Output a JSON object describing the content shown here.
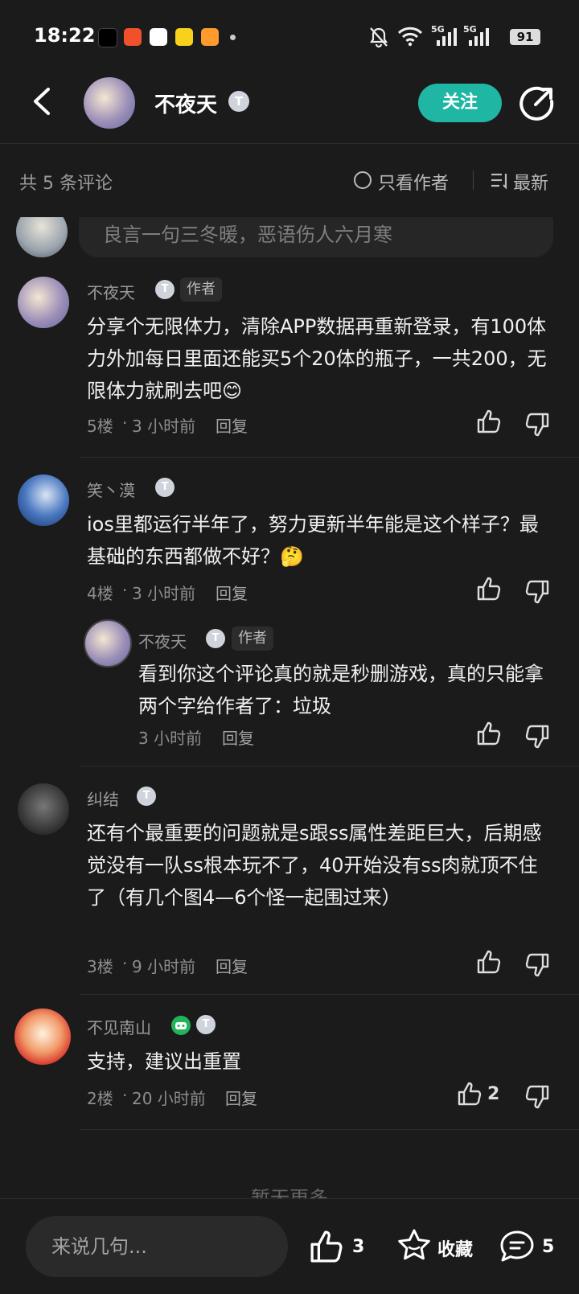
{
  "status_bar": {
    "time": "18:22",
    "network1": "5G",
    "network2": "5G",
    "battery": "91"
  },
  "header": {
    "user_name": "不夜天",
    "badge": "T",
    "follow_label": "关注"
  },
  "toolbar": {
    "comment_count": "共 5 条评论",
    "only_author": "只看作者",
    "sort_label": "最新"
  },
  "prev_comment": {
    "text": "良言一句三冬暖，恶语伤人六月寒"
  },
  "comments": [
    {
      "name": "不夜天",
      "badge": "T",
      "tag": "作者",
      "text": "分享个无限体力，清除APP数据再重新登录，有100体力外加每日里面还能买5个20体的瓶子，一共200，无限体力就刷去吧😊",
      "floor": "5楼",
      "time": "3 小时前",
      "reply": "回复"
    },
    {
      "name": "笑丶漠",
      "badge": "T",
      "text": "ios里都运行半年了，努力更新半年能是这个样子？最基础的东西都做不好？🤔",
      "floor": "4楼",
      "time": "3 小时前",
      "reply": "回复"
    },
    {
      "name": "纠结",
      "badge": "T",
      "text": "还有个最重要的问题就是s跟ss属性差距巨大，后期感觉没有一队ss根本玩不了，40开始没有ss肉就顶不住了（有几个图4—6个怪一起围过来）",
      "floor": "3楼",
      "time": "9 小时前",
      "reply": "回复"
    },
    {
      "name": "不见南山",
      "badge": "T",
      "text": "支持，建议出重置",
      "floor": "2楼",
      "time": "20 小时前",
      "reply": "回复",
      "likes": "2"
    }
  ],
  "reply": {
    "name": "不夜天",
    "badge": "T",
    "tag": "作者",
    "text": "看到你这个评论真的就是秒删游戏，真的只能拿两个字给作者了：垃圾",
    "time": "3 小时前",
    "reply": "回复"
  },
  "footer": {
    "no_more": "暂无更多"
  },
  "bottom_bar": {
    "placeholder": "来说几句...",
    "like_count": "3",
    "favorite_label": "收藏",
    "comment_count": "5"
  }
}
